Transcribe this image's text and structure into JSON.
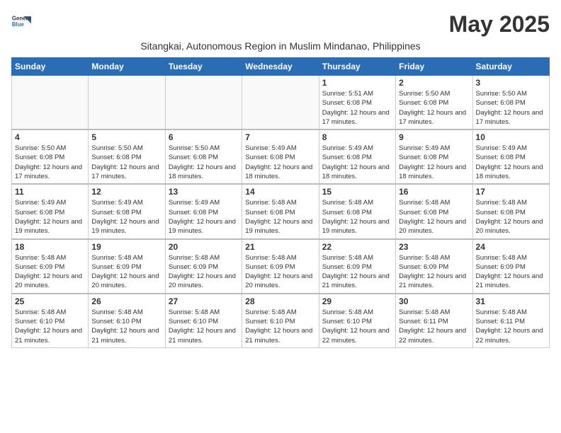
{
  "logo": {
    "line1": "General",
    "line2": "Blue"
  },
  "title": "May 2025",
  "subtitle": "Sitangkai, Autonomous Region in Muslim Mindanao, Philippines",
  "weekdays": [
    "Sunday",
    "Monday",
    "Tuesday",
    "Wednesday",
    "Thursday",
    "Friday",
    "Saturday"
  ],
  "weeks": [
    [
      {
        "day": "",
        "info": ""
      },
      {
        "day": "",
        "info": ""
      },
      {
        "day": "",
        "info": ""
      },
      {
        "day": "",
        "info": ""
      },
      {
        "day": "1",
        "info": "Sunrise: 5:51 AM\nSunset: 6:08 PM\nDaylight: 12 hours and 17 minutes."
      },
      {
        "day": "2",
        "info": "Sunrise: 5:50 AM\nSunset: 6:08 PM\nDaylight: 12 hours and 17 minutes."
      },
      {
        "day": "3",
        "info": "Sunrise: 5:50 AM\nSunset: 6:08 PM\nDaylight: 12 hours and 17 minutes."
      }
    ],
    [
      {
        "day": "4",
        "info": "Sunrise: 5:50 AM\nSunset: 6:08 PM\nDaylight: 12 hours and 17 minutes."
      },
      {
        "day": "5",
        "info": "Sunrise: 5:50 AM\nSunset: 6:08 PM\nDaylight: 12 hours and 17 minutes."
      },
      {
        "day": "6",
        "info": "Sunrise: 5:50 AM\nSunset: 6:08 PM\nDaylight: 12 hours and 18 minutes."
      },
      {
        "day": "7",
        "info": "Sunrise: 5:49 AM\nSunset: 6:08 PM\nDaylight: 12 hours and 18 minutes."
      },
      {
        "day": "8",
        "info": "Sunrise: 5:49 AM\nSunset: 6:08 PM\nDaylight: 12 hours and 18 minutes."
      },
      {
        "day": "9",
        "info": "Sunrise: 5:49 AM\nSunset: 6:08 PM\nDaylight: 12 hours and 18 minutes."
      },
      {
        "day": "10",
        "info": "Sunrise: 5:49 AM\nSunset: 6:08 PM\nDaylight: 12 hours and 18 minutes."
      }
    ],
    [
      {
        "day": "11",
        "info": "Sunrise: 5:49 AM\nSunset: 6:08 PM\nDaylight: 12 hours and 19 minutes."
      },
      {
        "day": "12",
        "info": "Sunrise: 5:49 AM\nSunset: 6:08 PM\nDaylight: 12 hours and 19 minutes."
      },
      {
        "day": "13",
        "info": "Sunrise: 5:49 AM\nSunset: 6:08 PM\nDaylight: 12 hours and 19 minutes."
      },
      {
        "day": "14",
        "info": "Sunrise: 5:48 AM\nSunset: 6:08 PM\nDaylight: 12 hours and 19 minutes."
      },
      {
        "day": "15",
        "info": "Sunrise: 5:48 AM\nSunset: 6:08 PM\nDaylight: 12 hours and 19 minutes."
      },
      {
        "day": "16",
        "info": "Sunrise: 5:48 AM\nSunset: 6:08 PM\nDaylight: 12 hours and 20 minutes."
      },
      {
        "day": "17",
        "info": "Sunrise: 5:48 AM\nSunset: 6:08 PM\nDaylight: 12 hours and 20 minutes."
      }
    ],
    [
      {
        "day": "18",
        "info": "Sunrise: 5:48 AM\nSunset: 6:09 PM\nDaylight: 12 hours and 20 minutes."
      },
      {
        "day": "19",
        "info": "Sunrise: 5:48 AM\nSunset: 6:09 PM\nDaylight: 12 hours and 20 minutes."
      },
      {
        "day": "20",
        "info": "Sunrise: 5:48 AM\nSunset: 6:09 PM\nDaylight: 12 hours and 20 minutes."
      },
      {
        "day": "21",
        "info": "Sunrise: 5:48 AM\nSunset: 6:09 PM\nDaylight: 12 hours and 20 minutes."
      },
      {
        "day": "22",
        "info": "Sunrise: 5:48 AM\nSunset: 6:09 PM\nDaylight: 12 hours and 21 minutes."
      },
      {
        "day": "23",
        "info": "Sunrise: 5:48 AM\nSunset: 6:09 PM\nDaylight: 12 hours and 21 minutes."
      },
      {
        "day": "24",
        "info": "Sunrise: 5:48 AM\nSunset: 6:09 PM\nDaylight: 12 hours and 21 minutes."
      }
    ],
    [
      {
        "day": "25",
        "info": "Sunrise: 5:48 AM\nSunset: 6:10 PM\nDaylight: 12 hours and 21 minutes."
      },
      {
        "day": "26",
        "info": "Sunrise: 5:48 AM\nSunset: 6:10 PM\nDaylight: 12 hours and 21 minutes."
      },
      {
        "day": "27",
        "info": "Sunrise: 5:48 AM\nSunset: 6:10 PM\nDaylight: 12 hours and 21 minutes."
      },
      {
        "day": "28",
        "info": "Sunrise: 5:48 AM\nSunset: 6:10 PM\nDaylight: 12 hours and 21 minutes."
      },
      {
        "day": "29",
        "info": "Sunrise: 5:48 AM\nSunset: 6:10 PM\nDaylight: 12 hours and 22 minutes."
      },
      {
        "day": "30",
        "info": "Sunrise: 5:48 AM\nSunset: 6:11 PM\nDaylight: 12 hours and 22 minutes."
      },
      {
        "day": "31",
        "info": "Sunrise: 5:48 AM\nSunset: 6:11 PM\nDaylight: 12 hours and 22 minutes."
      }
    ]
  ]
}
